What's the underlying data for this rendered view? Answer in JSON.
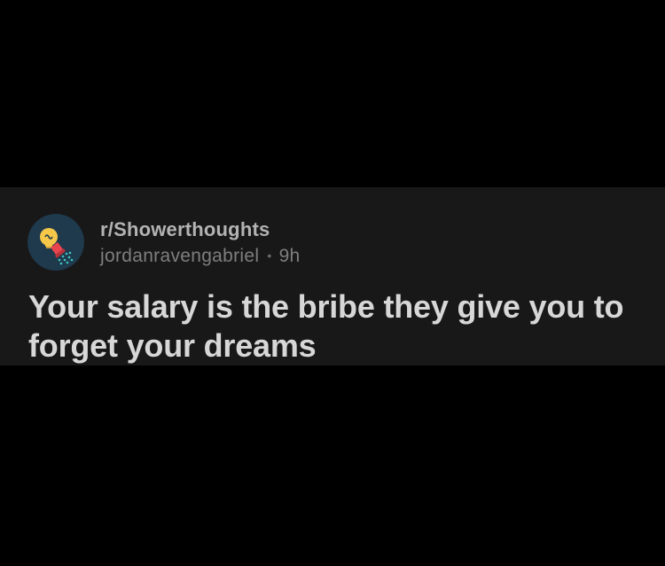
{
  "post": {
    "subreddit": "r/Showerthoughts",
    "author": "jordanravengabriel",
    "separator": "•",
    "age": "9h",
    "title": "Your salary is the bribe they give you to forget your dreams",
    "avatar_icon": "lightbulb-shower-icon"
  },
  "colors": {
    "page_background": "#000000",
    "card_background": "#181818",
    "subreddit_text": "#b3b3b3",
    "byline_text": "#7e7e7e",
    "title_text": "#d7d7d7",
    "avatar_background": "#1f3a4d",
    "bulb_yellow": "#f5c84a",
    "shower_head_red": "#e8454f",
    "water_teal": "#3fc5c0"
  }
}
